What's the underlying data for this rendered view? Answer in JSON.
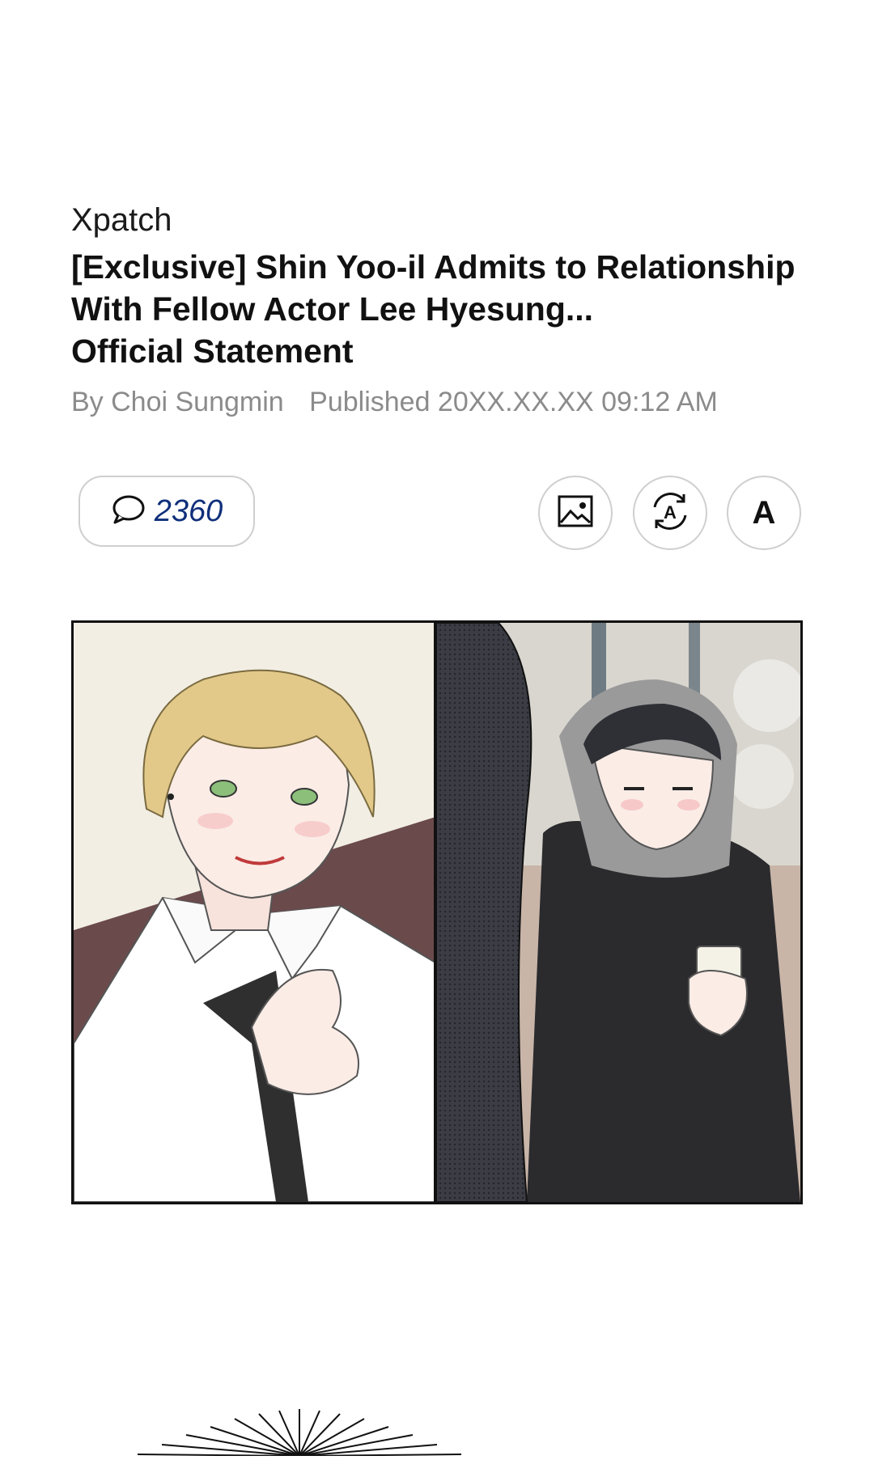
{
  "article": {
    "source": "Xpatch",
    "headline_lines": [
      "[Exclusive] Shin Yoo-il Admits to Relationship",
      "With Fellow Actor Lee Hyesung...",
      "Official Statement"
    ],
    "byline": {
      "author": "By Choi Sungmin",
      "published": "Published 20XX.XX.XX 09:12 AM"
    }
  },
  "toolbar": {
    "comment_count": "2360",
    "icons": [
      "comment-icon",
      "image-icon",
      "translate-icon",
      "font-size-icon"
    ],
    "font_button_label": "A",
    "accent_color": "#0f2f7a"
  },
  "illustration": {
    "panels": [
      "blonde-man-loosening-tie",
      "man-in-hoodie-holding-cup"
    ],
    "colors": {
      "left_bg": "#f2eee4",
      "sofa": "#6b4a4c",
      "hair": "#e2c98a",
      "hoodie": "#9a9a9a",
      "jacket": "#2b2b2e",
      "park_bg": "#c8b5a8"
    }
  }
}
